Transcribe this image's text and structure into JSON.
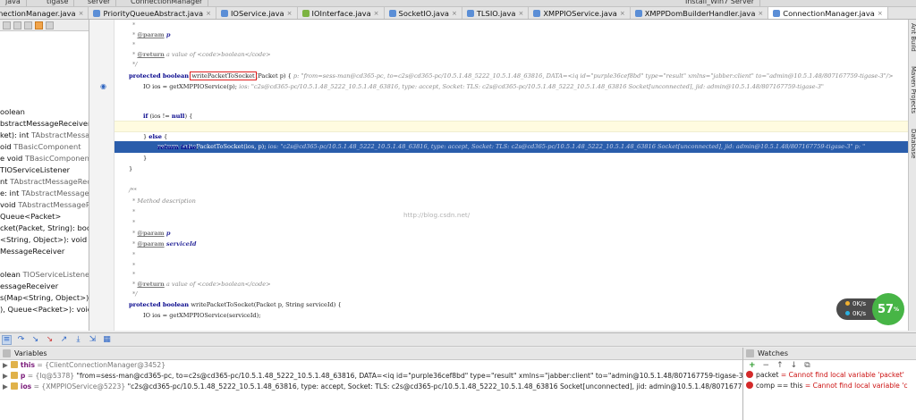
{
  "topbar": {
    "items": [
      "java",
      "tigase",
      "server",
      "ConnectionManager",
      "Install_Win7 Server"
    ]
  },
  "tabs": [
    {
      "label": "ConnectionManager.java",
      "color": "#5b8ed6"
    },
    {
      "label": "PriorityQueueAbstract.java",
      "color": "#5b8ed6"
    },
    {
      "label": "IOService.java",
      "color": "#5b8ed6"
    },
    {
      "label": "IOInterface.java",
      "color": "#7cb342"
    },
    {
      "label": "SocketIO.java",
      "color": "#5b8ed6"
    },
    {
      "label": "TLSIO.java",
      "color": "#5b8ed6"
    },
    {
      "label": "XMPPIOService.java",
      "color": "#5b8ed6"
    },
    {
      "label": "XMPPDomBuilderHandler.java",
      "color": "#5b8ed6"
    },
    {
      "label": "ConnectionManager.java",
      "color": "#5b8ed6"
    }
  ],
  "left_panel": {
    "items": [
      {
        "name": "oolean",
        "type": ""
      },
      {
        "name": "bstractMessageReceiver",
        "type": ""
      },
      {
        "name": "ket): int ",
        "type": "TAbstractMessageR"
      },
      {
        "name": "oid ",
        "type": "TBasicComponent"
      },
      {
        "name": "e void ",
        "type": "TBasicComponent"
      },
      {
        "name": "TIOServiceListener",
        "type": ""
      },
      {
        "name": "nt ",
        "type": "TAbstractMessageRecei"
      },
      {
        "name": "e: int ",
        "type": "TAbstractMessageRece"
      },
      {
        "name": "void ",
        "type": "TAbstractMessageRecei"
      },
      {
        "name": " Queue<Packet>",
        "type": ""
      },
      {
        "name": "cket(Packet, String): boolean",
        "type": ""
      },
      {
        "name": " <String, Object>): void",
        "type": ""
      },
      {
        "name": "MessageReceiver",
        "type": ""
      },
      {
        "name": "",
        "type": ""
      },
      {
        "name": "olean ",
        "type": "TIOServiceListener"
      },
      {
        "name": "essageReceiver",
        "type": ""
      },
      {
        "name": "s(Map<String, Object>): vo",
        "type": ""
      },
      {
        "name": "), Queue<Packet>): void",
        "type": ""
      }
    ]
  },
  "editor": {
    "c1": "*",
    "c2a": "* ",
    "c2b": "@param",
    "c2c": " p",
    "c3": "*",
    "c4a": "* ",
    "c4b": "@return",
    "c4c": "  a  value  of  ",
    "c4d": "<code>boolean</code>",
    "c5": "*/",
    "m1_kw": "protected boolean ",
    "m1_name": "writePacketToSocket",
    "m1_rest": "(Packet p) {  ",
    "m1_hint": "p: \"from=sess-man@cd365-pc, to=c2s@cd365-pc/10.5.1.48_5222_10.5.1.48_63816, DATA=<iq id=\"purple36cef8bd\" type=\"result\" xmlns=\"jabber:client\" to=\"admin@10.5.1.48/807167759-tigase-3\"/>",
    "m2_code": "IO ios = getXMPPIOService(p);  ",
    "m2_hint": "ios: \"c2s@cd365-pc/10.5.1.48_5222_10.5.1.48_63816, type: accept, Socket: TLS: c2s@cd365-pc/10.5.1.48_5222_10.5.1.48_63816 Socket[unconnected], jid: admin@10.5.1.48/807167759-tigase-3\"",
    "m3_kw": "if",
    "m3_rest": " (ios != ",
    "m3_null": "null",
    "m3_end": ") {",
    "m4_kw": "return",
    "m4_rest": " writePacketToSocket(ios, p);  ",
    "m4_hint": "ios: \"c2s@cd365-pc/10.5.1.48_5222_10.5.1.48_63816, type: accept, Socket: TLS: c2s@cd365-pc/10.5.1.48_5222_10.5.1.48_63816 Socket[unconnected], jid: admin@10.5.1.48/807167759-tigase-3\"  p: \"",
    "m5a": "} ",
    "m5_kw": "else",
    "m5b": " {",
    "m6_kw": "return",
    "m6_false": " false",
    "m6_end": ";",
    "m7": "}",
    "m8": "}",
    "d0": "/**",
    "d1": "* Method description",
    "d2": "*",
    "d3": "*",
    "d4a": "* ",
    "d4b": "@param",
    "d4c": " p",
    "d5a": "* ",
    "d5b": "@param",
    "d5c": " serviceId",
    "d6": "*",
    "d7": "*",
    "d8": "*",
    "d9a": "* ",
    "d9b": "@return",
    "d9c": "  a  value  of  ",
    "d9d": "<code>boolean</code>",
    "d10": "*/",
    "n1_kw": "protected boolean ",
    "n1_rest": "writePacketToSocket(Packet p, String serviceId) {",
    "n2": "IO ios = getXMPPIOService(serviceId);"
  },
  "watermark": "http://blog.csdn.net/",
  "right_strip": [
    "Ant Build",
    "Maven Projects",
    "Database"
  ],
  "net_widget": {
    "up": "0K/s",
    "down": "0K/s",
    "percent": "57",
    "unit": "%"
  },
  "variables": {
    "title": "Variables",
    "rows": [
      {
        "name": "this",
        "rest": " = {ClientConnectionManager@3452}",
        "val": ""
      },
      {
        "name": "p",
        "rest": " = {Iq@5378} ",
        "val": "\"from=sess-man@cd365-pc, to=c2s@cd365-pc/10.5.1.48_5222_10.5.1.48_63816, DATA=<iq id=\"purple36cef8bd\" type=\"result\" xmlns=\"jabber:client\" to=\"admin@10.5.1.48/807167759-tigase-3\"/>, SIZE=10:... View"
      },
      {
        "name": "ios",
        "rest": " = {XMPPIOService@5223} ",
        "val": "\"c2s@cd365-pc/10.5.1.48_5222_10.5.1.48_63816, type: accept, Socket: TLS: c2s@cd365-pc/10.5.1.48_5222_10.5.1.48_63816 Socket[unconnected], jid: admin@10.5.1.48/807167759-tigase-3\""
      }
    ]
  },
  "watches": {
    "title": "Watches",
    "rows": [
      {
        "expr": "packet",
        "val": " = Cannot find local variable 'packet'"
      },
      {
        "expr": "comp == this",
        "val": " = Cannot find local variable 'c"
      }
    ]
  }
}
